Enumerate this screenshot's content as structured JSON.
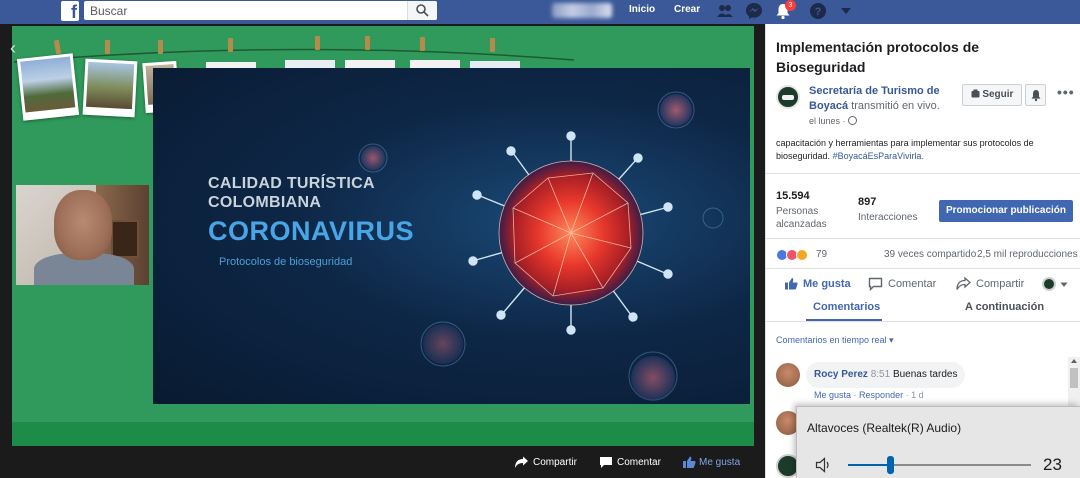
{
  "topbar": {
    "logo": "f",
    "search_placeholder": "Buscar",
    "home_label": "Inicio",
    "create_label": "Crear",
    "notification_count": "3"
  },
  "video": {
    "slide": {
      "line1": "CALIDAD TURÍSTICA",
      "line2": "COLOMBIANA",
      "title": "CORONAVIRUS",
      "subtitle": "Protocolos de bioseguridad"
    },
    "actions": {
      "share": "Compartir",
      "comment": "Comentar",
      "like": "Me gusta"
    }
  },
  "post": {
    "title": "Implementación protocolos de Bioseguridad",
    "page_name": "Secretaría de Turismo de Boyacá",
    "action": "transmitió en vivo.",
    "time": "el lunes ·",
    "follow_label": "Seguir",
    "more": "•••",
    "description": "capacitación y herramientas para implementar sus protocolos de bioseguridad.",
    "hashtag": "#BoyacáEsParaVivirla.",
    "stats": {
      "reach_value": "15.594",
      "reach_label_1": "Personas",
      "reach_label_2": "alcanzadas",
      "interactions_value": "897",
      "interactions_label": "Interacciones"
    },
    "promote_label": "Promocionar publicación",
    "reactions_count": "79",
    "shares": "39 veces compartido",
    "views": "2,5 mil reproducciones",
    "actions": {
      "like": "Me gusta",
      "comment": "Comentar",
      "share": "Compartir"
    },
    "tabs": {
      "comments": "Comentarios",
      "next": "A continuación"
    },
    "comments_filter": "Comentarios en tiempo real ▾",
    "comments": [
      {
        "name": "Rocy Perez",
        "time": "8:51",
        "text": "Buenas tardes",
        "like": "Me gusta",
        "reply": "Responder",
        "age": "1 d"
      }
    ]
  },
  "volume": {
    "device": "Altavoces (Realtek(R) Audio)",
    "level": "23",
    "level_fraction": 0.23
  },
  "colors": {
    "facebook_blue": "#3b5998",
    "link_blue": "#365899",
    "button_blue": "#4267b2",
    "slide_green": "#2f9a5b",
    "volume_accent": "#0063b1"
  }
}
